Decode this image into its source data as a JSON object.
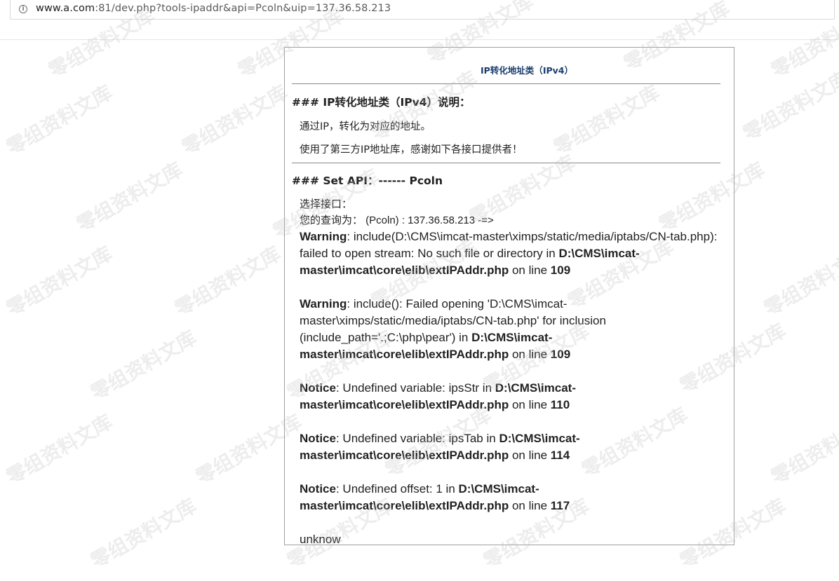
{
  "browser": {
    "url_host": "www.a.com",
    "url_rest": ":81/dev.php?tools-ipaddr&api=Pcoln&uip=137.36.58.213",
    "info_glyph": "i"
  },
  "panel": {
    "title": "IP转化地址类（IPv4）",
    "section1_heading": "### IP转化地址类（IPv4）说明：",
    "desc1": "通过IP，转化为对应的地址。",
    "desc2": "使用了第三方IP地址库，感谢如下各接口提供者！",
    "section2_heading": "### Set API：------ Pcoln",
    "select_label": "选择接口：",
    "query_line": "您的查询为：  (Pcoln) : 137.36.58.213 -=>",
    "messages": [
      {
        "level": "Warning",
        "text": ": include(D:\\CMS\\imcat-master\\ximps/static/media/iptabs/CN-tab.php): failed to open stream: No such file or directory in ",
        "file": "D:\\CMS\\imcat-master\\imcat\\core\\elib\\extIPAddr.php",
        "on_line": " on line ",
        "line": "109"
      },
      {
        "level": "Warning",
        "text": ": include(): Failed opening 'D:\\CMS\\imcat-master\\ximps/static/media/iptabs/CN-tab.php' for inclusion (include_path='.;C:\\php\\pear') in ",
        "file": "D:\\CMS\\imcat-master\\imcat\\core\\elib\\extIPAddr.php",
        "on_line": " on line ",
        "line": "109"
      },
      {
        "level": "Notice",
        "text": ": Undefined variable: ipsStr in ",
        "file": "D:\\CMS\\imcat-master\\imcat\\core\\elib\\extIPAddr.php",
        "on_line": " on line ",
        "line": "110"
      },
      {
        "level": "Notice",
        "text": ": Undefined variable: ipsTab in ",
        "file": "D:\\CMS\\imcat-master\\imcat\\core\\elib\\extIPAddr.php",
        "on_line": " on line ",
        "line": "114"
      },
      {
        "level": "Notice",
        "text": ": Undefined offset: 1 in ",
        "file": "D:\\CMS\\imcat-master\\imcat\\core\\elib\\extIPAddr.php",
        "on_line": " on line ",
        "line": "117"
      }
    ],
    "result": "unknow"
  },
  "watermark": "零组资料文库"
}
